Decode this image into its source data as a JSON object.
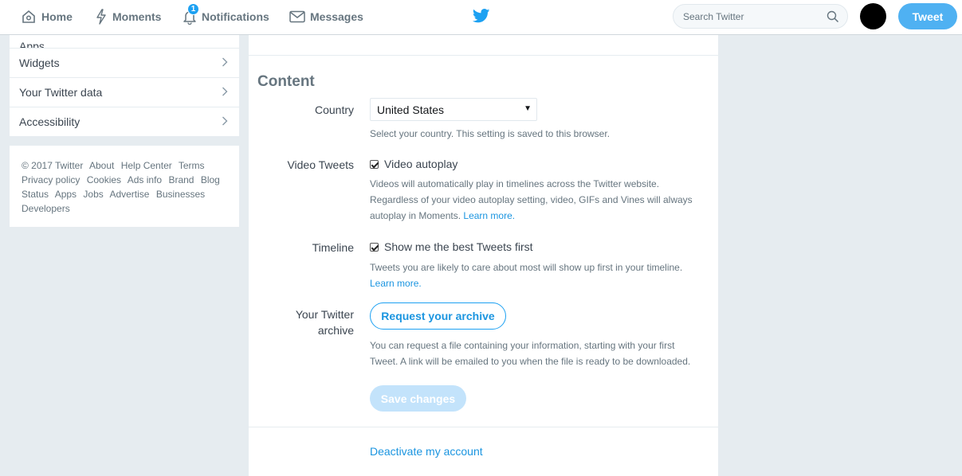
{
  "nav": {
    "home": "Home",
    "moments": "Moments",
    "notifications": "Notifications",
    "notifications_count": "1",
    "messages": "Messages",
    "search_placeholder": "Search Twitter",
    "tweet_button": "Tweet"
  },
  "sidebar": {
    "items": [
      {
        "label": "Apps"
      },
      {
        "label": "Widgets"
      },
      {
        "label": "Your Twitter data"
      },
      {
        "label": "Accessibility"
      }
    ],
    "footer_links": [
      "© 2017 Twitter",
      "About",
      "Help Center",
      "Terms",
      "Privacy policy",
      "Cookies",
      "Ads info",
      "Brand",
      "Blog",
      "Status",
      "Apps",
      "Jobs",
      "Advertise",
      "Businesses",
      "Developers"
    ]
  },
  "content": {
    "title": "Content",
    "country": {
      "label": "Country",
      "value": "United States",
      "help": "Select your country. This setting is saved to this browser."
    },
    "video": {
      "label": "Video Tweets",
      "checkbox": "Video autoplay",
      "checked": true,
      "help": "Videos will automatically play in timelines across the Twitter website. Regardless of your video autoplay setting, video, GIFs and Vines will always autoplay in Moments.",
      "link": "Learn more."
    },
    "timeline": {
      "label": "Timeline",
      "checkbox": "Show me the best Tweets first",
      "checked": true,
      "help": "Tweets you are likely to care about most will show up first in your timeline.",
      "link": "Learn more."
    },
    "archive": {
      "label_line1": "Your Twitter",
      "label_line2": "archive",
      "button": "Request your archive",
      "help": "You can request a file containing your information, starting with your first Tweet. A link will be emailed to you when the file is ready to be downloaded."
    },
    "save_button": "Save changes",
    "deactivate": "Deactivate my account"
  },
  "colors": {
    "accent": "#1da1f2",
    "background": "#e6ecf0"
  }
}
